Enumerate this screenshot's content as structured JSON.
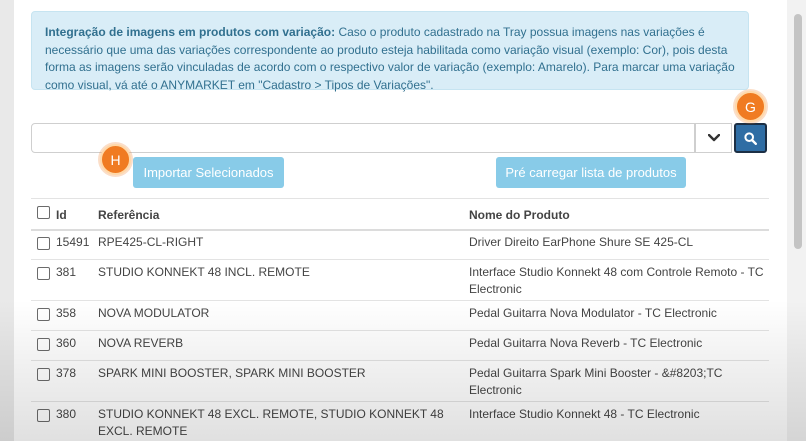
{
  "info": {
    "title": "Integração de imagens em produtos com variação:",
    "text": "Caso o produto cadastrado na Tray possua imagens nas variações é necessário que uma das variações correspondente ao produto esteja habilitada como variação visual (exemplo: Cor), pois desta forma as imagens serão vinculadas de acordo com o respectivo valor de variação (exemplo: Amarelo). Para marcar uma variação como visual, vá até o ANYMARKET em \"Cadastro > Tipos de Variações\"."
  },
  "search": {
    "value": "",
    "placeholder": ""
  },
  "buttons": {
    "import_label": "Importar Selecionados",
    "preload_label": "Pré carregar lista de produtos"
  },
  "markers": {
    "g": "G",
    "h": "H"
  },
  "table": {
    "headers": {
      "id": "Id",
      "ref": "Referência",
      "name": "Nome do Produto"
    },
    "rows": [
      {
        "id": "15491",
        "ref": "RPE425-CL-RIGHT",
        "name": "Driver Direito EarPhone Shure SE 425-CL"
      },
      {
        "id": "381",
        "ref": "STUDIO KONNEKT 48 INCL. REMOTE",
        "name": "Interface Studio Konnekt 48 com Controle Remoto - TC Electronic"
      },
      {
        "id": "358",
        "ref": "NOVA MODULATOR",
        "name": "Pedal Guitarra Nova Modulator - TC Electronic"
      },
      {
        "id": "360",
        "ref": "NOVA REVERB",
        "name": "Pedal Guitarra Nova Reverb - TC Electronic"
      },
      {
        "id": "378",
        "ref": "SPARK MINI BOOSTER, SPARK MINI BOOSTER",
        "name": "Pedal Guitarra Spark Mini Booster - &#8203;TC Electronic"
      },
      {
        "id": "380",
        "ref": "STUDIO KONNEKT 48 EXCL. REMOTE, STUDIO KONNEKT 48 EXCL. REMOTE",
        "name": "Interface Studio Konnekt 48 - TC Electronic"
      }
    ]
  },
  "colors": {
    "info_bg": "#d9edf7",
    "info_text": "#31708f",
    "primary_button": "#2f6da4",
    "light_button": "#88cbe8",
    "marker": "#f07b22"
  },
  "icons": [
    "chevron-down-icon",
    "search-icon",
    "checkbox-icon"
  ]
}
